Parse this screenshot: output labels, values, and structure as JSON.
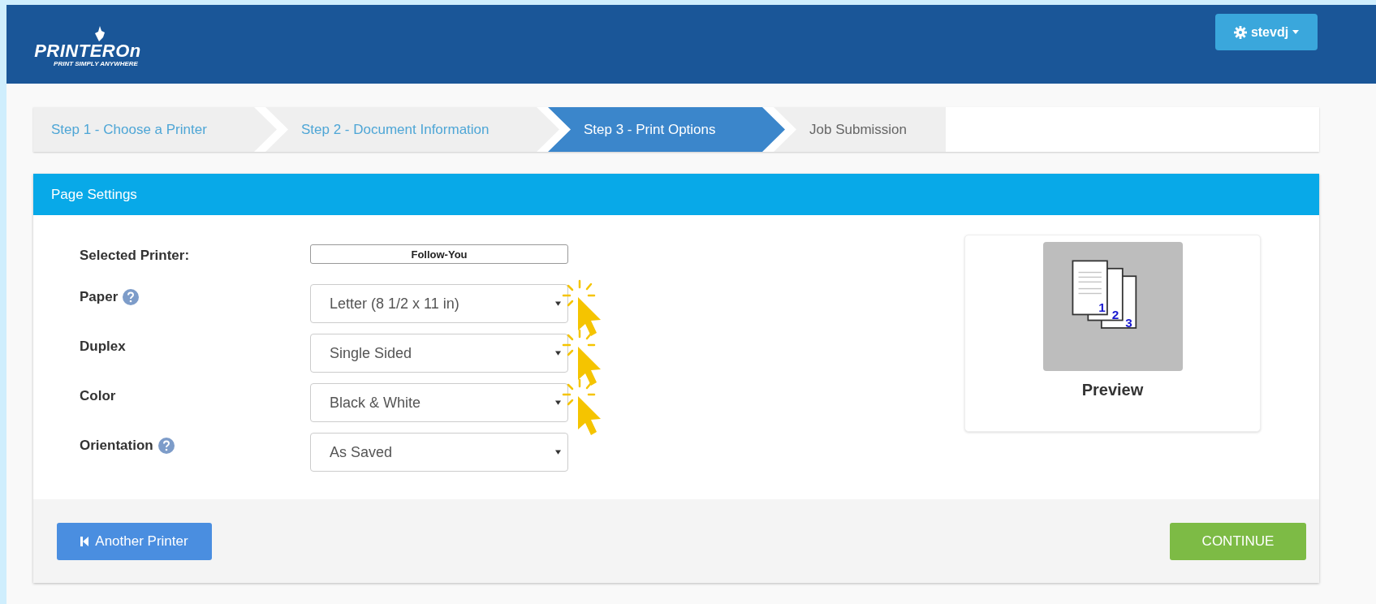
{
  "header": {
    "logo": {
      "name": "PRINTEROn",
      "tagline": "PRINT SIMPLY ANYWHERE"
    },
    "user_menu": {
      "label": "stevdj"
    }
  },
  "steps": [
    {
      "label": "Step 1 - Choose a Printer",
      "selected": false
    },
    {
      "label": "Step 2 - Document Information",
      "selected": false
    },
    {
      "label": "Step 3 - Print Options",
      "selected": true
    },
    {
      "label": "Job Submission",
      "selected": false
    }
  ],
  "panel": {
    "title": "Page Settings",
    "selected_printer": {
      "label": "Selected Printer:",
      "value": "Follow-You"
    },
    "fields": [
      {
        "label": "Paper",
        "help": true,
        "value": "Letter (8 1/2 x 11 in)",
        "highlighted": true
      },
      {
        "label": "Duplex",
        "help": false,
        "value": "Single Sided",
        "highlighted": true
      },
      {
        "label": "Color",
        "help": false,
        "value": "Black & White",
        "highlighted": true
      },
      {
        "label": "Orientation",
        "help": true,
        "value": "As Saved",
        "highlighted": false
      }
    ],
    "preview": {
      "label": "Preview",
      "page_numbers": [
        "1",
        "2",
        "3"
      ]
    },
    "buttons": {
      "back": "Another Printer",
      "next": "CONTINUE"
    }
  }
}
